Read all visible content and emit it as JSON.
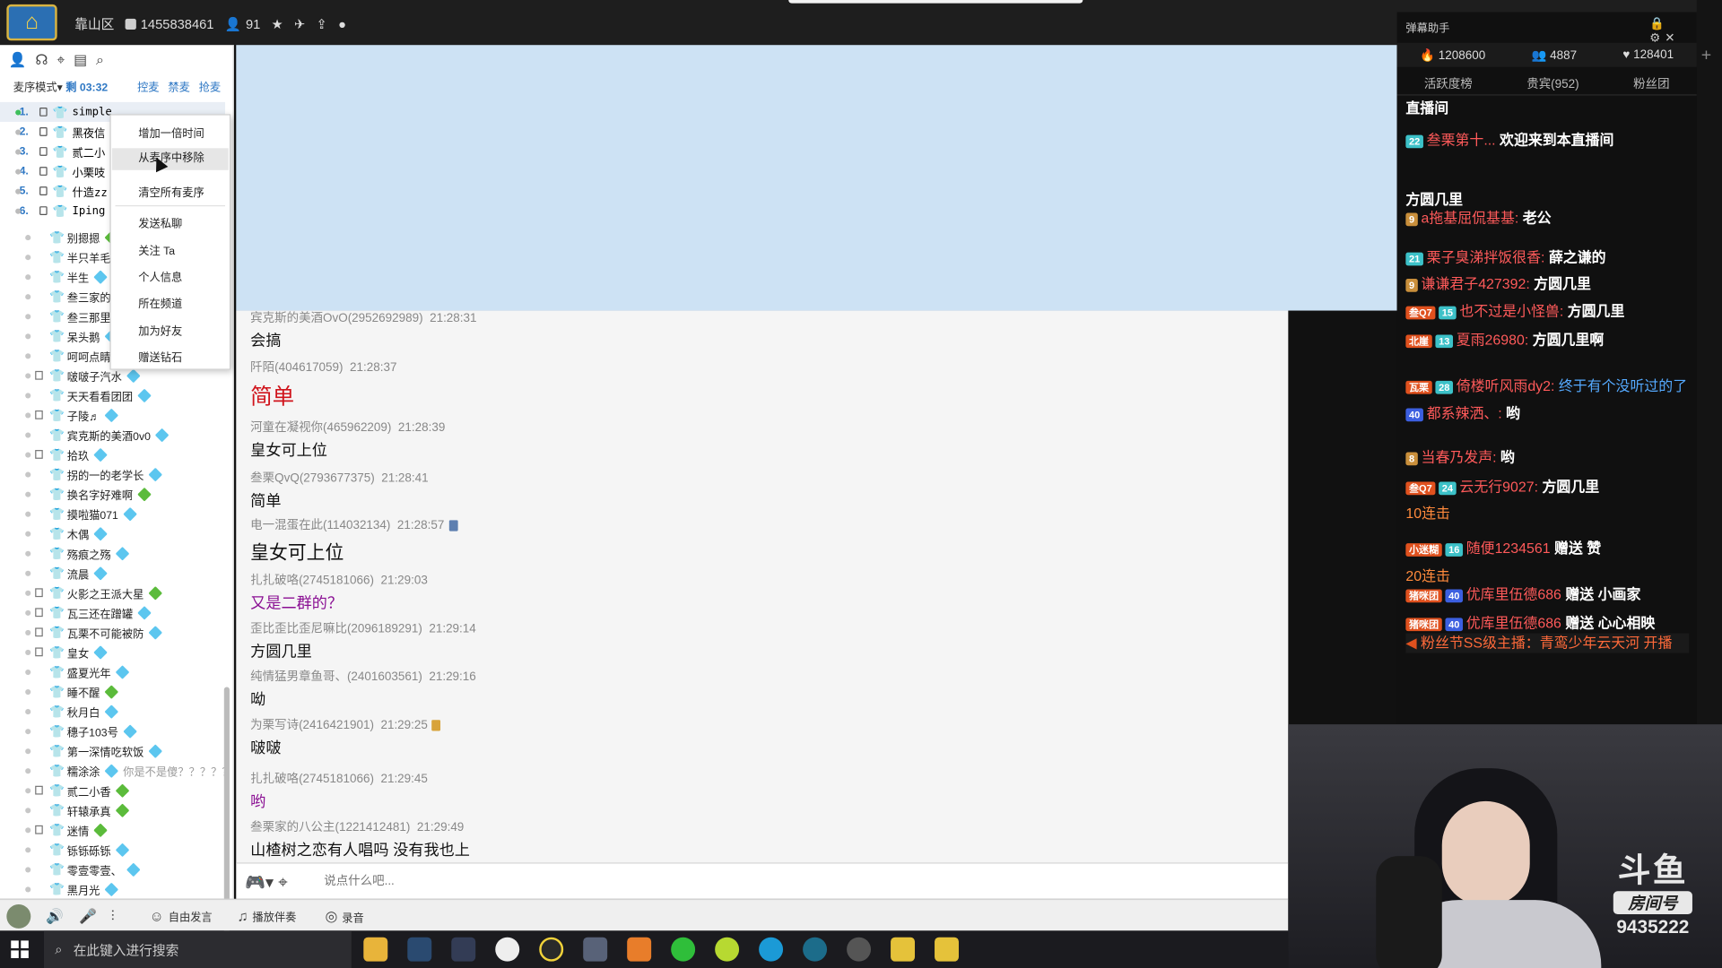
{
  "topbar": {
    "location": "靠山区",
    "room_id": "1455838461",
    "online": "91"
  },
  "leftpanel": {
    "mode": "麦序模式",
    "mode_arrow": "▾",
    "remaining": "剩 03:32",
    "actions": [
      "控麦",
      "禁麦",
      "抢麦"
    ],
    "queue": [
      {
        "num": "1.",
        "name": "simple"
      },
      {
        "num": "2.",
        "name": "黑夜信"
      },
      {
        "num": "3.",
        "name": "贰二小"
      },
      {
        "num": "4.",
        "name": "小栗吱"
      },
      {
        "num": "5.",
        "name": "什造zz"
      },
      {
        "num": "6.",
        "name": "Iping"
      }
    ],
    "users": [
      {
        "name": "别摁摁",
        "gem": "g",
        "sq": false
      },
      {
        "name": "半只羊毛",
        "gem": "b",
        "sq": false
      },
      {
        "name": "半生",
        "gem": "b",
        "sq": false
      },
      {
        "name": "叁三家的",
        "gem": "",
        "sq": false
      },
      {
        "name": "叁三那里",
        "gem": "",
        "sq": false
      },
      {
        "name": "呆头鹅",
        "gem": "b",
        "sq": false
      },
      {
        "name": "呵呵点睛",
        "gem": "",
        "sq": false
      },
      {
        "name": "啵啵子汽水",
        "gem": "b",
        "sq": true
      },
      {
        "name": "天天看看团团",
        "gem": "b",
        "sq": false
      },
      {
        "name": "子陵♬",
        "gem": "b",
        "sq": true
      },
      {
        "name": "宾克斯的美酒0v0",
        "gem": "b",
        "sq": false
      },
      {
        "name": "拾玖",
        "gem": "b",
        "sq": true
      },
      {
        "name": "拐的一的老学长",
        "gem": "b",
        "sq": false
      },
      {
        "name": "换名字好难啊",
        "gem": "g",
        "sq": false
      },
      {
        "name": "摸啦猫071",
        "gem": "b",
        "sq": false
      },
      {
        "name": "木偶",
        "gem": "b",
        "sq": false
      },
      {
        "name": "殇痕之殇",
        "gem": "b",
        "sq": false
      },
      {
        "name": "流晨",
        "gem": "b",
        "sq": false
      },
      {
        "name": "火影之王派大星",
        "gem": "g",
        "sq": true
      },
      {
        "name": "瓦三还在蹭罐",
        "gem": "b",
        "sq": true
      },
      {
        "name": "瓦栗不可能被防",
        "gem": "b",
        "sq": true
      },
      {
        "name": "皇女",
        "gem": "b",
        "sq": true
      },
      {
        "name": "盛夏光年",
        "gem": "b",
        "sq": false
      },
      {
        "name": "睡不醒",
        "gem": "g",
        "sq": false
      },
      {
        "name": "秋月白",
        "gem": "b",
        "sq": false
      },
      {
        "name": "穗子103号",
        "gem": "b",
        "sq": false
      },
      {
        "name": "第一深情吃软饭",
        "gem": "b",
        "sq": false
      },
      {
        "name": "糯涂涂",
        "gem": "b",
        "sq": false,
        "extra": "你是不是傻？？？？？"
      },
      {
        "name": "贰二小香",
        "gem": "g",
        "sq": true
      },
      {
        "name": "轩辕承真",
        "gem": "g",
        "sq": false
      },
      {
        "name": "迷情",
        "gem": "g",
        "sq": true
      },
      {
        "name": "铄铄砾铄",
        "gem": "b",
        "sq": false
      },
      {
        "name": "零壹零壹、",
        "gem": "b",
        "sq": false
      },
      {
        "name": "黑月光",
        "gem": "b",
        "sq": false
      }
    ]
  },
  "context_menu": {
    "items": [
      "增加一倍时间",
      "从麦序中移除",
      "清空所有麦序",
      "发送私聊",
      "关注 Ta",
      "个人信息",
      "所在频道",
      "加为好友",
      "赠送钻石"
    ]
  },
  "chat": {
    "messages": [
      {
        "user": "宾克斯的美酒OvO(2952692989)",
        "time": "21:28:31",
        "text": "会搞",
        "style": ""
      },
      {
        "user": "阡陌(404617059)",
        "time": "21:28:37",
        "text": "简单",
        "style": "red"
      },
      {
        "user": "河童在凝视你(465962209)",
        "time": "21:28:39",
        "text": "皇女可上位",
        "style": ""
      },
      {
        "user": "叁栗QvQ(2793677375)",
        "time": "21:28:41",
        "text": "简单",
        "style": ""
      },
      {
        "user": "电一混蛋在此(114032134)",
        "time": "21:28:57",
        "text": "皇女可上位",
        "style": "big",
        "icon": "blue"
      },
      {
        "user": "扎扎破咯(2745181066)",
        "time": "21:29:03",
        "text": "又是二群的？",
        "style": "purple"
      },
      {
        "user": "歪比歪比歪尼嘛比(2096189291)",
        "time": "21:29:14",
        "text": "方圆几里",
        "style": ""
      },
      {
        "user": "纯情猛男章鱼哥、(2401603561)",
        "time": "21:29:16",
        "text": "呦",
        "style": ""
      },
      {
        "user": "为栗写诗(2416421901)",
        "time": "21:29:25",
        "text": "啵啵",
        "style": "",
        "icon": "gold"
      },
      {
        "user": "扎扎破咯(2745181066)",
        "time": "21:29:45",
        "text": "哟",
        "style": "purple"
      },
      {
        "user": "叁栗家的八公主(1221412481)",
        "time": "21:29:49",
        "text": "山楂树之恋有人唱吗 没有我也上",
        "style": ""
      }
    ]
  },
  "input": {
    "placeholder": "说点什么吧..."
  },
  "bottombar": {
    "free_speak": "自由发言",
    "accompany": "播放伴奏",
    "record": "录音"
  },
  "danmu": {
    "title": "弹幕助手",
    "stats": {
      "heat": "1208600",
      "members": "4887",
      "likes": "128401"
    },
    "tabs": [
      "活跃度榜",
      "贵宾(952)",
      "粉丝团"
    ],
    "lines": [
      {
        "a": "直播间",
        "type": "sys"
      },
      {
        "badge": "22",
        "name": "叁栗第十...",
        "text": "欢迎来到本直播间"
      },
      {
        "a": "方圆几里",
        "type": "sys"
      },
      {
        "badge": "9",
        "name": "a拖基屈侃基基:",
        "text": "老公"
      },
      {
        "badge": "21",
        "name": "栗子臭涕拌饭很香:",
        "text": "薛之谦的",
        "multi": "瓦栗"
      },
      {
        "badge": "9",
        "name": "谦谦君子427392:",
        "text": "方圆几里"
      },
      {
        "badge": "15",
        "name": "也不过是小怪兽:",
        "text": "方圆几里",
        "tag": "叁Q7"
      },
      {
        "badge": "13",
        "name": "夏雨26980:",
        "text": "方圆几里啊",
        "tag": "北崖"
      },
      {
        "badge": "28",
        "name": "倚楼听风雨dy2:",
        "text": "终于有个没听过的了",
        "tag": "瓦栗"
      },
      {
        "badge": "40",
        "name": "都系辣洒、:",
        "text": "哟"
      },
      {
        "badge": "8",
        "name": "当春乃发声:",
        "text": "哟"
      },
      {
        "badge": "24",
        "name": "云无行9027:",
        "text": "方圆几里",
        "tag": "叁Q7"
      },
      {
        "combo": "10连击"
      },
      {
        "badge": "16",
        "name": "随便1234561",
        "gift": "赠送 赞",
        "tag": "小迷糊"
      },
      {
        "combo": "20连击"
      },
      {
        "badge": "40",
        "name": "优库里伍德686",
        "gift": "赠送 小画家",
        "tag": "猪咪团"
      },
      {
        "badge": "40",
        "name": "优库里伍德686",
        "gift": "赠送 心心相映",
        "tag": "猪咪团"
      },
      {
        "announce": "粉丝节SS级主播：青鸾少年云天河 开播"
      }
    ]
  },
  "cam": {
    "brand": "斗鱼",
    "room_label": "房间号",
    "room_num": "9435222"
  },
  "taskbar": {
    "search": "在此键入进行搜索"
  }
}
